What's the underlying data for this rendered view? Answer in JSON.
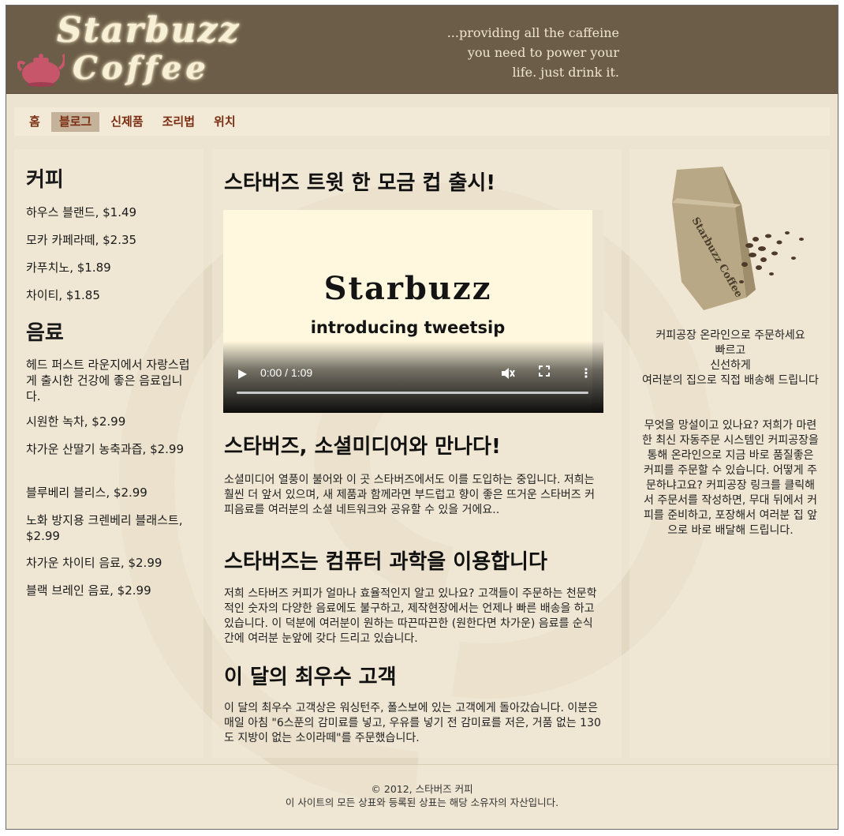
{
  "header": {
    "logo_line1": "Starbuzz",
    "logo_line2": "Coffee",
    "tagline": [
      "...providing all the caffeine",
      "you need to power your",
      "life. just drink it."
    ]
  },
  "nav": {
    "items": [
      {
        "label": "홈"
      },
      {
        "label": "블로그",
        "active": true
      },
      {
        "label": "신제품"
      },
      {
        "label": "조리법"
      },
      {
        "label": "위치"
      }
    ]
  },
  "sidebar": {
    "coffee_heading": "커피",
    "coffee_items": [
      "하우스 블랜드, $1.49",
      "모카 카페라떼, $2.35",
      "카푸치노, $1.89",
      "차이티, $1.85"
    ],
    "drinks_heading": "음료",
    "drinks_intro": "헤드 퍼스트 라운지에서 자랑스럽게 출시한 건강에 좋은 음료입니다.",
    "drink_items": [
      "시원한 녹차, $2.99",
      "차가운 산딸기 농축과즙, $2.99",
      "블루베리 블리스, $2.99",
      "노화 방지용 크렌베리 블래스트, $2.99",
      "차가운 차이티 음료, $2.99",
      "블랙 브레인 음료, $2.99"
    ]
  },
  "main": {
    "post1_title": "스타버즈 트윗 한 모금 컵 출시!",
    "video": {
      "title": "Starbuzz",
      "subtitle": "introducing tweetsip",
      "time": "0:00 / 1:09",
      "progress": 0
    },
    "post2_title": "스타버즈, 소셜미디어와 만나다!",
    "post2_body": "소셜미디어 열풍이 불어와 이 곳 스타버즈에서도 이를 도입하는 중입니다. 저희는 훨씬 더 앞서 있으며, 새 제품과 함께라면 부드럽고 향이 좋은 뜨거운 스타버즈 커피음료를 여러분의 소셜 네트워크와 공유할 수 있을 거에요..",
    "post3_title": "스타버즈는 컴퓨터 과학을 이용합니다",
    "post3_body": "저희 스타버즈 커피가 얼마나 효율적인지 알고 있나요? 고객들이 주문하는 천문학적인 숫자의 다양한 음료에도 불구하고, 제작현장에서는 언제나 빠른 배송을 하고 있습니다. 이 덕분에 여러분이 원하는 따끈따끈한 (원한다면 차가운) 음료를 순식간에 여러분 눈앞에 갖다 드리고 있습니다.",
    "post4_title": "이 달의 최우수 고객",
    "post4_body": "이 달의 최우수 고객상은 워싱턴주, 폴스보에 있는 고객에게 돌아갔습니다. 이분은 매일 아침 \"6스푼의 감미료를 넣고, 우유를 넣기 전 감미료를 저은, 거품 없는 130도 지방이 없는 소이라떼\"를 주문했습니다."
  },
  "aside": {
    "bag_text": "Starbuzz Coffee",
    "promo1": [
      "커피공장 온라인으로 주문하세요",
      "빠르고",
      "신선하게",
      "여러분의 집으로 직접 배송해 드립니다"
    ],
    "promo2": "무엇을 망설이고 있나요? 저희가 마련한 최신 자동주문 시스템인 커피공장을 통해 온라인으로 지금 바로 품질좋은 커피를 주문할 수 있습니다. 어떻게 주문하냐고요? 커피공장 링크를 클릭해서 주문서를 작성하면, 무대 뒤에서 커피를 준비하고, 포장해서 여러분 집 앞으로 바로 배달해 드립니다."
  },
  "footer": {
    "copyright": "© 2012, 스타버즈 커피",
    "notice": "이 사이트의 모든 상표와 등록된 상표는 해당 소유자의 자산입니다."
  }
}
